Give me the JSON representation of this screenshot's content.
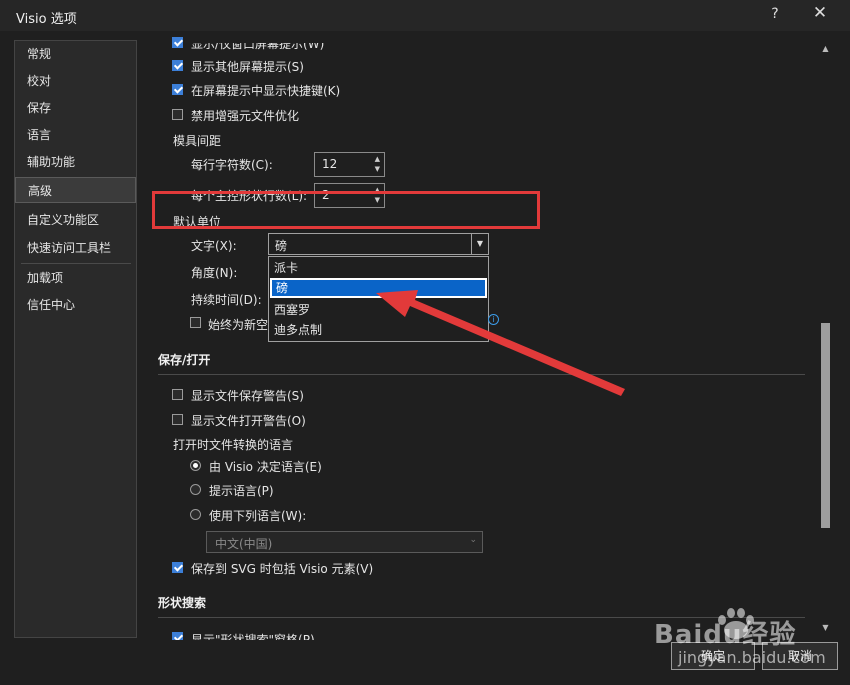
{
  "window": {
    "title": "Visio 选项",
    "help": "?",
    "close": "✕"
  },
  "sidebar": {
    "items": [
      {
        "label": "常规"
      },
      {
        "label": "校对"
      },
      {
        "label": "保存"
      },
      {
        "label": "语言"
      },
      {
        "label": "辅助功能"
      },
      {
        "label": "高级"
      },
      {
        "label": "自定义功能区"
      },
      {
        "label": "快速访问工具栏"
      },
      {
        "label": "加载项"
      },
      {
        "label": "信任中心"
      }
    ],
    "active": "高级"
  },
  "display": {
    "partial_top": "显示/仅窗口屏幕提示(W)",
    "other_screentips": "显示其他屏幕提示(S)",
    "shortcut_keys": "在屏幕提示中显示快捷键(K)",
    "disable_enhanced": "禁用增强元文件优化"
  },
  "grid": {
    "label": "模具间距",
    "chars_label": "每行字符数(C):",
    "chars_value": "12",
    "rows_label": "每个主控形状行数(L):",
    "rows_value": "2"
  },
  "units": {
    "label": "默认单位",
    "text_label": "文字(X):",
    "text_value": "磅",
    "angle_label": "角度(N):",
    "duration_label": "持续时间(D):",
    "always_new_label": "始终为新空",
    "options": [
      "派卡",
      "磅",
      "西塞罗",
      "迪多点制"
    ],
    "selected_option": "磅"
  },
  "save_open": {
    "title": "保存/打开",
    "save_warning": "显示文件保存警告(S)",
    "open_warning": "显示文件打开警告(O)",
    "convert_lang_label": "打开时文件转换的语言",
    "radio_visio": "由 Visio 决定语言(E)",
    "radio_prompt": "提示语言(P)",
    "radio_use": "使用下列语言(W):",
    "lang_select": "中文(中国)",
    "svg_include": "保存到 SVG 时包括 Visio 元素(V)"
  },
  "shape_search": {
    "title": "形状搜索",
    "partial": "显示\"形状搜索\"窗格(P)"
  },
  "footer": {
    "ok": "确定",
    "cancel": "取消"
  },
  "watermark": {
    "brand": "Baidu经验",
    "url": "jingyan.baidu.com"
  },
  "colors": {
    "accent": "#3c7fd8",
    "highlight": "#e23a3a",
    "selection": "#0a64c8"
  }
}
